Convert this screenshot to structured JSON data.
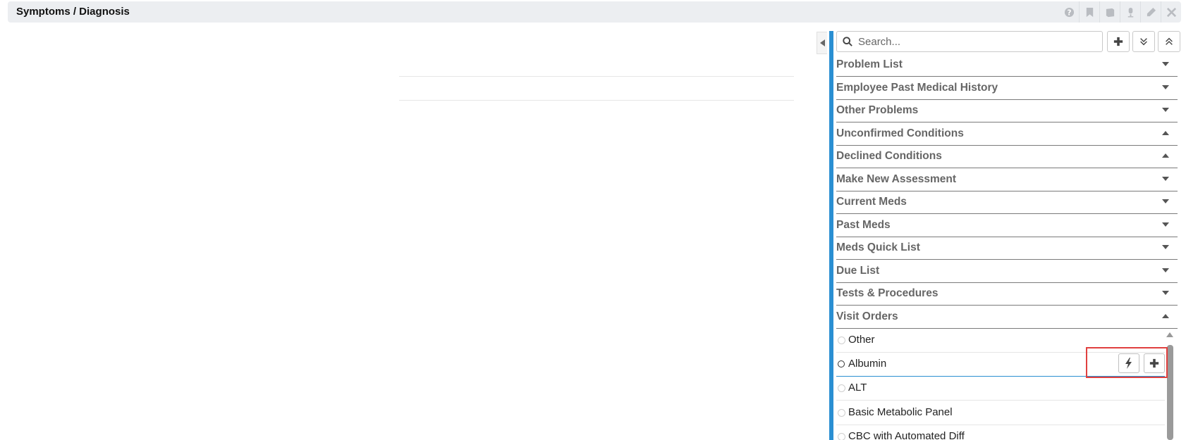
{
  "window": {
    "title": "Symptoms / Diagnosis",
    "icons": [
      "help-icon",
      "bookmark-icon",
      "book-icon",
      "microphone-icon",
      "pencil-icon",
      "close-icon"
    ]
  },
  "search": {
    "placeholder": "Search..."
  },
  "sections": [
    {
      "label": "Problem List",
      "state": "collapsed"
    },
    {
      "label": "Employee Past Medical History",
      "state": "collapsed"
    },
    {
      "label": "Other Problems",
      "state": "collapsed"
    },
    {
      "label": "Unconfirmed Conditions",
      "state": "expanded"
    },
    {
      "label": "Declined Conditions",
      "state": "expanded"
    },
    {
      "label": "Make New Assessment",
      "state": "collapsed"
    },
    {
      "label": "Current Meds",
      "state": "collapsed"
    },
    {
      "label": "Past Meds",
      "state": "collapsed"
    },
    {
      "label": "Meds Quick List",
      "state": "collapsed"
    },
    {
      "label": "Due List",
      "state": "collapsed"
    },
    {
      "label": "Tests & Procedures",
      "state": "collapsed"
    },
    {
      "label": "Visit Orders",
      "state": "expanded"
    }
  ],
  "visit_orders": [
    {
      "label": "Other"
    },
    {
      "label": "Albumin"
    },
    {
      "label": "ALT"
    },
    {
      "label": "Basic Metabolic Panel"
    },
    {
      "label": "CBC with Automated Diff"
    }
  ],
  "colors": {
    "accent": "#2a8fd2",
    "highlight": "#e0403f"
  }
}
